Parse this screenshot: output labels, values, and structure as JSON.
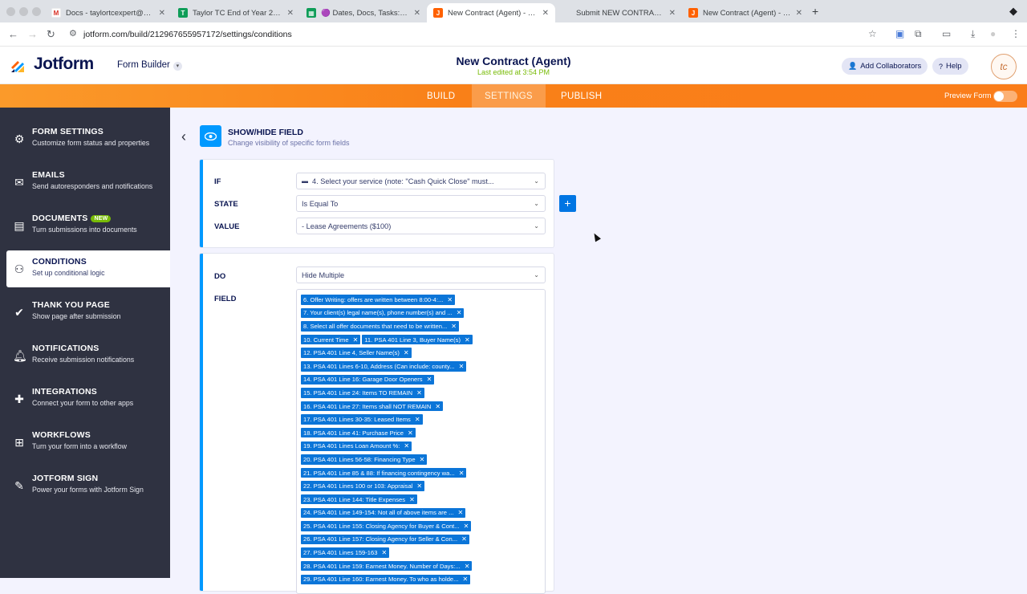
{
  "browser": {
    "tabs": [
      {
        "label": "Docs - taylortcexpert@gmail...",
        "icon": "gmail-icon"
      },
      {
        "label": "Taylor TC End of Year 2025 -",
        "icon": "sheets-icon"
      },
      {
        "label": "🟣 Dates, Docs, Tasks: Dates",
        "icon": "sheets-icon"
      },
      {
        "label": "New Contract (Agent) - Jotfo",
        "icon": "jotform-icon"
      },
      {
        "label": "Submit NEW CONTRACT | Tay",
        "icon": "blank-icon"
      },
      {
        "label": "New Contract (Agent) - Jotfo",
        "icon": "jotform-icon"
      }
    ],
    "url": "jotform.com/build/212967655957172/settings/conditions"
  },
  "header": {
    "logo": "Jotform",
    "form_builder": "Form Builder",
    "form_title": "New Contract (Agent)",
    "last_edited": "Last edited at 3:54 PM",
    "add_collaborators": "Add Collaborators",
    "help": "Help",
    "avatar_initials": "tc"
  },
  "nav": {
    "build": "BUILD",
    "settings": "SETTINGS",
    "publish": "PUBLISH",
    "preview_form": "Preview Form"
  },
  "sidebar": {
    "items": [
      {
        "title": "FORM SETTINGS",
        "desc": "Customize form status and properties"
      },
      {
        "title": "EMAILS",
        "desc": "Send autoresponders and notifications"
      },
      {
        "title": "DOCUMENTS",
        "desc": "Turn submissions into documents",
        "badge": "NEW"
      },
      {
        "title": "CONDITIONS",
        "desc": "Set up conditional logic"
      },
      {
        "title": "THANK YOU PAGE",
        "desc": "Show page after submission"
      },
      {
        "title": "NOTIFICATIONS",
        "desc": "Receive submission notifications"
      },
      {
        "title": "INTEGRATIONS",
        "desc": "Connect your form to other apps"
      },
      {
        "title": "WORKFLOWS",
        "desc": "Turn your form into a workflow"
      },
      {
        "title": "JOTFORM SIGN",
        "desc": "Power your forms with Jotform Sign"
      }
    ]
  },
  "condition": {
    "title": "SHOW/HIDE FIELD",
    "subtitle": "Change visibility of specific form fields",
    "if_label": "IF",
    "if_value": "4. Select your service (note: \"Cash Quick Close\" must...",
    "state_label": "STATE",
    "state_value": "Is Equal To",
    "value_label": "VALUE",
    "value_value": "- Lease Agreements ($100)",
    "do_label": "DO",
    "do_value": "Hide Multiple",
    "field_label": "FIELD",
    "fields": [
      [
        "6. Offer Writing: offers are written between 8:00-4:..."
      ],
      [
        "7. Your client(s) legal name(s), phone number(s) and ..."
      ],
      [
        "8. Select all offer documents that need to be written..."
      ],
      [
        "10. Current Time",
        "11. PSA 401 Line 3, Buyer Name(s)"
      ],
      [
        "12. PSA 401 Line 4, Seller Name(s)"
      ],
      [
        "13. PSA 401 Lines 6-10, Address (Can include: county..."
      ],
      [
        "14. PSA 401 Line 16: Garage Door Openers"
      ],
      [
        "15. PSA 401 Line 24: Items TO REMAIN"
      ],
      [
        "16. PSA 401 Line 27: Items shall NOT REMAIN"
      ],
      [
        "17. PSA 401 Lines 30-35: Leased Items"
      ],
      [
        "18. PSA 401 Line 41: Purchase Price"
      ],
      [
        "19. PSA 401 Lines Loan Amount %:"
      ],
      [
        "20. PSA 401 Lines 56-58: Financing Type"
      ],
      [
        "21. PSA 401 Line 85 & 88: If financing contingency wa..."
      ],
      [
        "22. PSA 401 Lines 100 or 103: Appraisal"
      ],
      [
        "23. PSA 401 Line 144: Title Expenses"
      ],
      [
        "24. PSA 401 Line 149-154: Not all of above items are ..."
      ],
      [
        "25. PSA 401 Line 155: Closing Agency for Buyer & Cont..."
      ],
      [
        "26. PSA 401 Line 157: Closing Agency for Seller & Con..."
      ],
      [
        "27. PSA 401 Lines 159-163"
      ],
      [
        "28. PSA 401 Line 159: Earnest Money. Number of Days:..."
      ],
      [
        "29. PSA 401 Line 160: Earnest Money. To who as holde..."
      ]
    ]
  },
  "colors": {
    "accent_blue": "#0099ff",
    "tag_blue": "#0b75d8",
    "sidebar_bg": "#2f3241",
    "orange": "#f98018",
    "green": "#78bb07"
  }
}
